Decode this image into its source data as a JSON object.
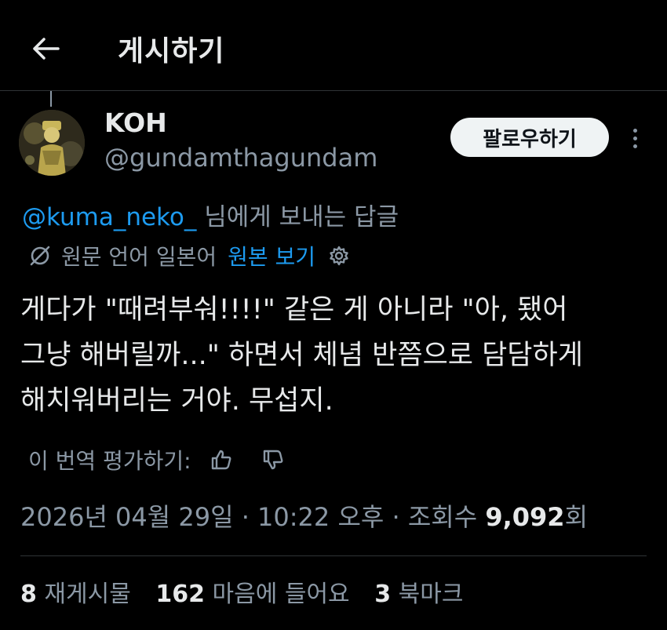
{
  "header": {
    "title": "게시하기",
    "back_icon": "arrow-left-icon"
  },
  "author": {
    "display_name": "KOH",
    "handle": "@gundamthagundam"
  },
  "follow_button": "팔로우하기",
  "reply_to": {
    "mention": "@kuma_neko_",
    "suffix": " 님에게 보내는 답글"
  },
  "translation": {
    "label": "원문 언어 일본어",
    "view_original": "원본 보기"
  },
  "tweet": {
    "lines": [
      "게다가 \"때려부숴!!!!\" 같은 게 아니라 \"아, 됐어",
      "그냥 해버릴까...\" 하면서 체념 반쯤으로 담담하게",
      "해치워버리는 거야. 무섭지."
    ]
  },
  "rate_translation": {
    "label": "이 번역 평가하기:"
  },
  "meta": {
    "timestamp": "2026년 04월 29일 · 10:22 오후 · 조회수 ",
    "views": "9,092",
    "views_suffix": "회"
  },
  "stats": {
    "reposts_count": "8",
    "reposts_label": " 재게시물",
    "likes_count": "162",
    "likes_label": " 마음에 들어요",
    "bookmarks_count": "3",
    "bookmarks_label": " 북마크"
  },
  "colors": {
    "background": "#000000",
    "text": "#e7e9ea",
    "muted": "#8b98a5",
    "link": "#1d9bf0",
    "follow_bg": "#eff3f4"
  }
}
